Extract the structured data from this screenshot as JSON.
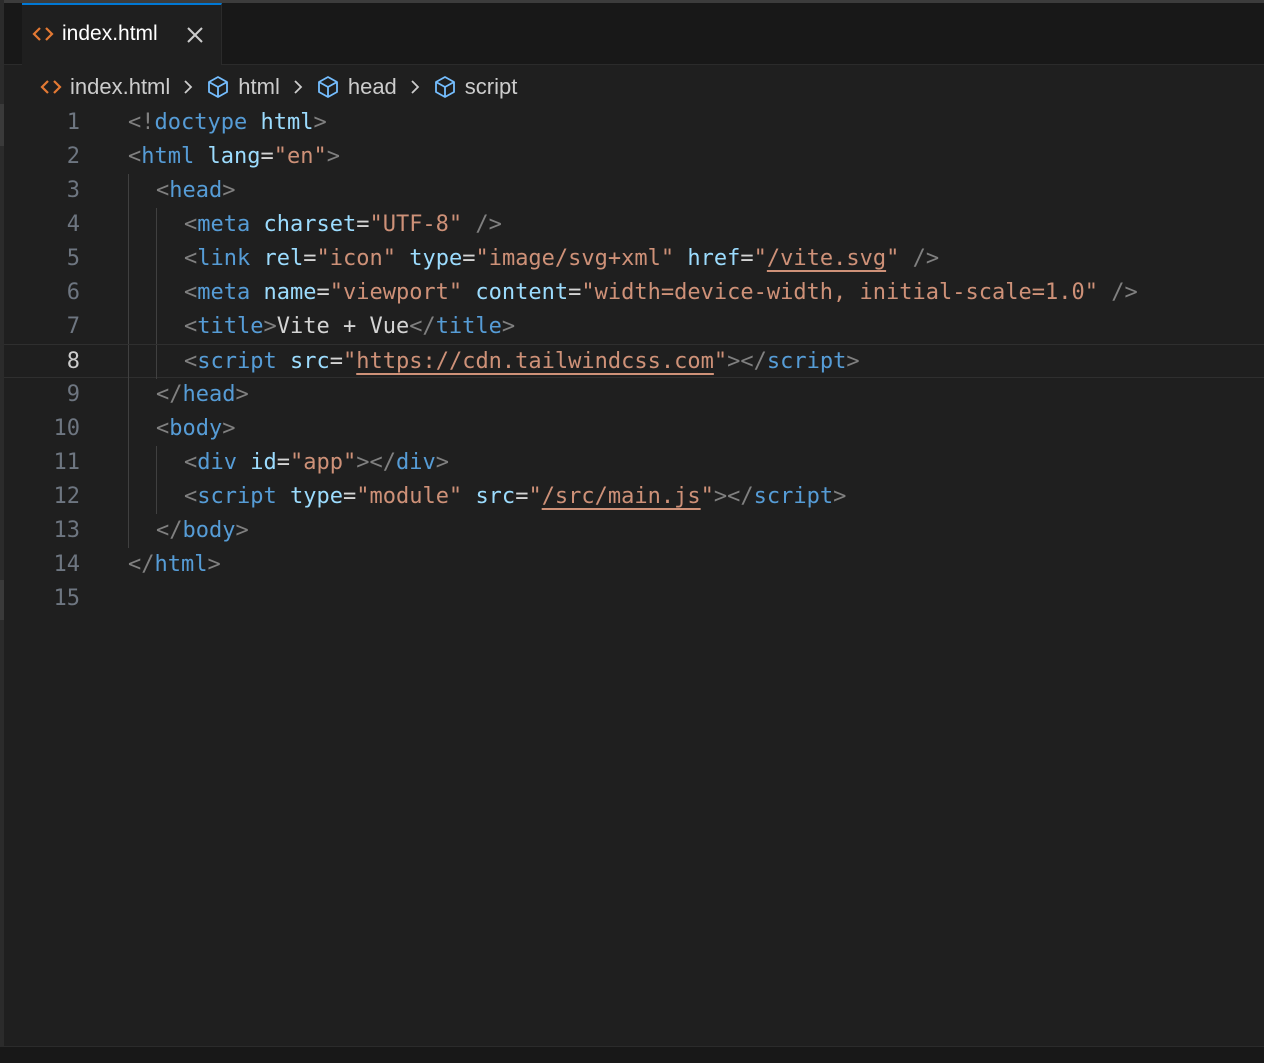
{
  "tab": {
    "label": "index.html",
    "file_icon": "html-file-icon",
    "close_icon": "close-icon"
  },
  "breadcrumb": {
    "items": [
      "index.html",
      "html",
      "head",
      "script"
    ],
    "element_icon": "cube-icon",
    "separator_icon": "chevron-right-icon"
  },
  "colors": {
    "tag": "#569cd6",
    "attribute": "#9cdcfe",
    "string": "#ce9178",
    "punctuation": "#808080",
    "text": "#d4d4d4",
    "line_number": "#6e7681",
    "active_tab_border": "#0078d4",
    "file_icon": "#e37933"
  },
  "editor": {
    "current_line": 8,
    "line_numbers": [
      "1",
      "2",
      "3",
      "4",
      "5",
      "6",
      "7",
      "8",
      "9",
      "10",
      "11",
      "12",
      "13",
      "14",
      "15"
    ],
    "lines": [
      {
        "indent": 0,
        "tokens": [
          [
            "p",
            "<!"
          ],
          [
            "t",
            "doctype"
          ],
          [
            "x",
            " "
          ],
          [
            "a",
            "html"
          ],
          [
            "p",
            ">"
          ]
        ]
      },
      {
        "indent": 0,
        "tokens": [
          [
            "p",
            "<"
          ],
          [
            "t",
            "html"
          ],
          [
            "x",
            " "
          ],
          [
            "a",
            "lang"
          ],
          [
            "x",
            "="
          ],
          [
            "s",
            "\"en\""
          ],
          [
            "p",
            ">"
          ]
        ]
      },
      {
        "indent": 1,
        "tokens": [
          [
            "p",
            "<"
          ],
          [
            "t",
            "head"
          ],
          [
            "p",
            ">"
          ]
        ]
      },
      {
        "indent": 2,
        "tokens": [
          [
            "p",
            "<"
          ],
          [
            "t",
            "meta"
          ],
          [
            "x",
            " "
          ],
          [
            "a",
            "charset"
          ],
          [
            "x",
            "="
          ],
          [
            "s",
            "\"UTF-8\""
          ],
          [
            "x",
            " "
          ],
          [
            "p",
            "/>"
          ]
        ]
      },
      {
        "indent": 2,
        "tokens": [
          [
            "p",
            "<"
          ],
          [
            "t",
            "link"
          ],
          [
            "x",
            " "
          ],
          [
            "a",
            "rel"
          ],
          [
            "x",
            "="
          ],
          [
            "s",
            "\"icon\""
          ],
          [
            "x",
            " "
          ],
          [
            "a",
            "type"
          ],
          [
            "x",
            "="
          ],
          [
            "s",
            "\"image/svg+xml\""
          ],
          [
            "x",
            " "
          ],
          [
            "a",
            "href"
          ],
          [
            "x",
            "="
          ],
          [
            "s",
            "\""
          ],
          [
            "su",
            "/vite.svg"
          ],
          [
            "s",
            "\""
          ],
          [
            "x",
            " "
          ],
          [
            "p",
            "/>"
          ]
        ]
      },
      {
        "indent": 2,
        "tokens": [
          [
            "p",
            "<"
          ],
          [
            "t",
            "meta"
          ],
          [
            "x",
            " "
          ],
          [
            "a",
            "name"
          ],
          [
            "x",
            "="
          ],
          [
            "s",
            "\"viewport\""
          ],
          [
            "x",
            " "
          ],
          [
            "a",
            "content"
          ],
          [
            "x",
            "="
          ],
          [
            "s",
            "\"width=device-width, initial-scale=1.0\""
          ],
          [
            "x",
            " "
          ],
          [
            "p",
            "/>"
          ]
        ]
      },
      {
        "indent": 2,
        "tokens": [
          [
            "p",
            "<"
          ],
          [
            "t",
            "title"
          ],
          [
            "p",
            ">"
          ],
          [
            "x",
            "Vite + Vue"
          ],
          [
            "p",
            "</"
          ],
          [
            "t",
            "title"
          ],
          [
            "p",
            ">"
          ]
        ]
      },
      {
        "indent": 2,
        "tokens": [
          [
            "p",
            "<"
          ],
          [
            "t",
            "script"
          ],
          [
            "x",
            " "
          ],
          [
            "a",
            "src"
          ],
          [
            "x",
            "="
          ],
          [
            "s",
            "\""
          ],
          [
            "su",
            "https://cdn.tailwindcss.com"
          ],
          [
            "s",
            "\""
          ],
          [
            "p",
            "></"
          ],
          [
            "t",
            "script"
          ],
          [
            "p",
            ">"
          ]
        ]
      },
      {
        "indent": 1,
        "tokens": [
          [
            "p",
            "</"
          ],
          [
            "t",
            "head"
          ],
          [
            "p",
            ">"
          ]
        ]
      },
      {
        "indent": 1,
        "tokens": [
          [
            "p",
            "<"
          ],
          [
            "t",
            "body"
          ],
          [
            "p",
            ">"
          ]
        ]
      },
      {
        "indent": 2,
        "tokens": [
          [
            "p",
            "<"
          ],
          [
            "t",
            "div"
          ],
          [
            "x",
            " "
          ],
          [
            "a",
            "id"
          ],
          [
            "x",
            "="
          ],
          [
            "s",
            "\"app\""
          ],
          [
            "p",
            "></"
          ],
          [
            "t",
            "div"
          ],
          [
            "p",
            ">"
          ]
        ]
      },
      {
        "indent": 2,
        "tokens": [
          [
            "p",
            "<"
          ],
          [
            "t",
            "script"
          ],
          [
            "x",
            " "
          ],
          [
            "a",
            "type"
          ],
          [
            "x",
            "="
          ],
          [
            "s",
            "\"module\""
          ],
          [
            "x",
            " "
          ],
          [
            "a",
            "src"
          ],
          [
            "x",
            "="
          ],
          [
            "s",
            "\""
          ],
          [
            "su",
            "/src/main.js"
          ],
          [
            "s",
            "\""
          ],
          [
            "p",
            "></"
          ],
          [
            "t",
            "script"
          ],
          [
            "p",
            ">"
          ]
        ]
      },
      {
        "indent": 1,
        "tokens": [
          [
            "p",
            "</"
          ],
          [
            "t",
            "body"
          ],
          [
            "p",
            ">"
          ]
        ]
      },
      {
        "indent": 0,
        "tokens": [
          [
            "p",
            "</"
          ],
          [
            "t",
            "html"
          ],
          [
            "p",
            ">"
          ]
        ]
      },
      {
        "indent": 0,
        "tokens": []
      }
    ]
  }
}
